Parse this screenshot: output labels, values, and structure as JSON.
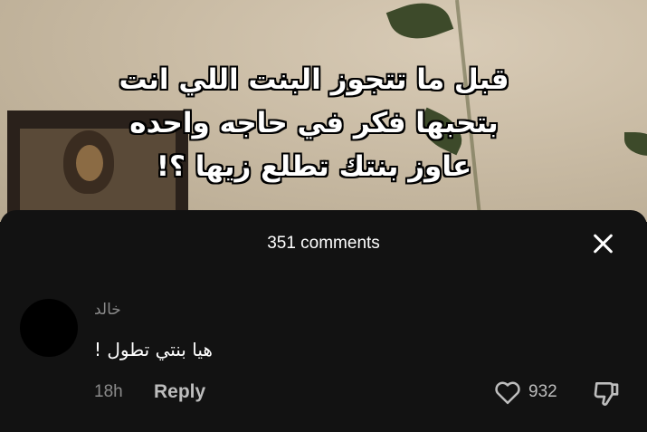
{
  "video": {
    "caption_lines": [
      "قبل ما تتجوز البنت اللي انت",
      "بتحبها فكر في حاجه واحده",
      "عاوز بنتك تطلع زيها ؟!"
    ]
  },
  "comments_panel": {
    "count_label": "351 comments",
    "comment": {
      "username": "خالد",
      "text": "هيا بنتي تطول !",
      "time": "18h",
      "reply_label": "Reply",
      "like_count": "932"
    }
  },
  "icons": {
    "close": "close-icon",
    "like": "heart-icon",
    "dislike": "thumbs-down-icon"
  },
  "colors": {
    "panel_bg": "#121212",
    "muted_text": "#8a8a8a"
  }
}
